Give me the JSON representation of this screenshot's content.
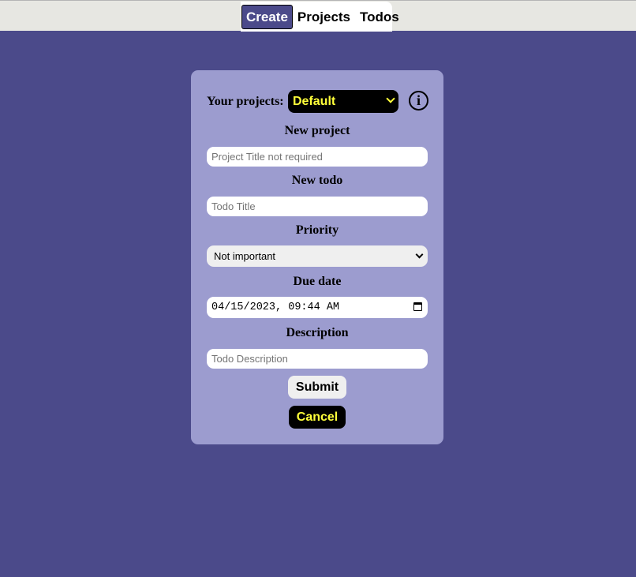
{
  "nav": {
    "tabs": [
      {
        "label": "Create",
        "active": true
      },
      {
        "label": "Projects",
        "active": false
      },
      {
        "label": "Todos",
        "active": false
      }
    ]
  },
  "form": {
    "projects_label": "Your projects:",
    "projects_selected": "Default",
    "info_icon": "i",
    "new_project_label": "New project",
    "project_title_placeholder": "Project Title not required",
    "new_todo_label": "New todo",
    "todo_title_placeholder": "Todo Title",
    "priority_label": "Priority",
    "priority_selected": "Not important",
    "due_date_label": "Due date",
    "due_date_value": "04/15/2023, 09:44 AM",
    "description_label": "Description",
    "description_placeholder": "Todo Description",
    "submit_label": "Submit",
    "cancel_label": "Cancel"
  },
  "colors": {
    "background": "#4b4a8a",
    "card": "#9c9ccf",
    "accent_text": "#ffff3a"
  }
}
